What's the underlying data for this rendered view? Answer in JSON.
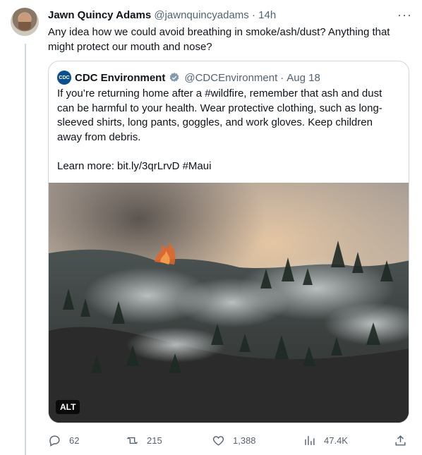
{
  "tweet": {
    "author_name": "Jawn Quincy Adams",
    "handle": "@jawnquincyadams",
    "separator": "·",
    "time": "14h",
    "more_label": "···",
    "text": "Any idea how we could avoid breathing in smoke/ash/dust? Anything that might protect our mouth and nose?"
  },
  "quote": {
    "logo_text": "CDC",
    "author_name": "CDC Environment",
    "handle": "@CDCEnvironment",
    "separator": "·",
    "date": "Aug 18",
    "text_p1": "If you’re returning home after a #wildfire, remember that ash and dust can be harmful to your health. Wear protective clothing, such as long-sleeved shirts, long pants, goggles, and work gloves. Keep children away from debris.",
    "text_p2": "Learn more: bit.ly/3qrLrvD #Maui",
    "alt_label": "ALT"
  },
  "actions": {
    "replies": "62",
    "retweets": "215",
    "likes": "1,388",
    "views": "47.4K"
  },
  "colors": {
    "verified": "#829aab",
    "muted_text": "#536471",
    "border": "#cfd9de"
  }
}
